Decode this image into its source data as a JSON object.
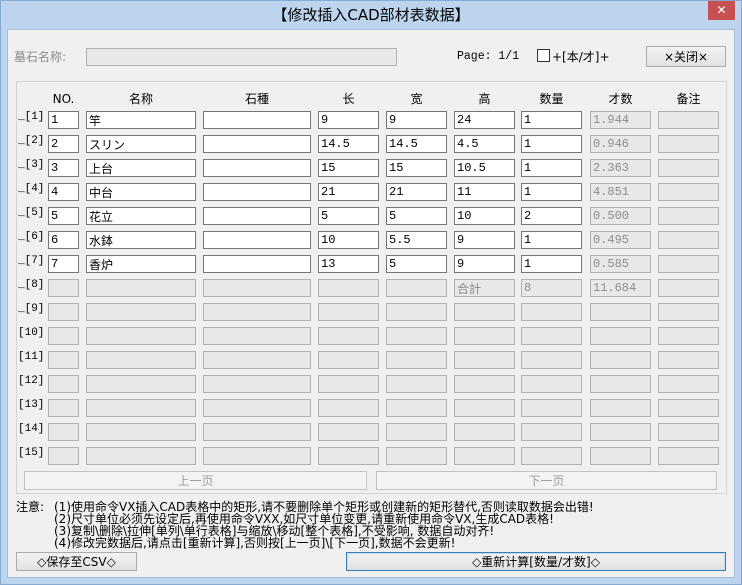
{
  "window": {
    "title": "【修改插入CAD部材表数据】",
    "close_glyph": "✕"
  },
  "header": {
    "name_label": "墓石名称:",
    "name_value": "",
    "page_text": "Page: 1/1",
    "unit_checkbox": {
      "label": "+[本/才]+",
      "checked": false
    },
    "close_button": "×关闭×"
  },
  "table": {
    "columns": [
      {
        "label": "NO.",
        "editable": true
      },
      {
        "label": "名称",
        "editable": true
      },
      {
        "label": "石種",
        "editable": true
      },
      {
        "label": "长",
        "editable": true
      },
      {
        "label": "宽",
        "editable": true
      },
      {
        "label": "高",
        "editable": true
      },
      {
        "label": "数量",
        "editable": true
      },
      {
        "label": "才数",
        "editable": false
      },
      {
        "label": "备注",
        "editable": false
      }
    ],
    "rows": [
      {
        "label": "_[1]",
        "active": true,
        "cells": [
          "1",
          "竿",
          "",
          "9",
          "9",
          "24",
          "1",
          "1.944",
          ""
        ]
      },
      {
        "label": "_[2]",
        "active": true,
        "cells": [
          "2",
          "スリン",
          "",
          "14.5",
          "14.5",
          "4.5",
          "1",
          "0.946",
          ""
        ]
      },
      {
        "label": "_[3]",
        "active": true,
        "cells": [
          "3",
          "上台",
          "",
          "15",
          "15",
          "10.5",
          "1",
          "2.363",
          ""
        ]
      },
      {
        "label": "_[4]",
        "active": true,
        "cells": [
          "4",
          "中台",
          "",
          "21",
          "21",
          "11",
          "1",
          "4.851",
          ""
        ]
      },
      {
        "label": "_[5]",
        "active": true,
        "cells": [
          "5",
          "花立",
          "",
          "5",
          "5",
          "10",
          "2",
          "0.500",
          ""
        ]
      },
      {
        "label": "_[6]",
        "active": true,
        "cells": [
          "6",
          "水鉢",
          "",
          "10",
          "5.5",
          "9",
          "1",
          "0.495",
          ""
        ]
      },
      {
        "label": "_[7]",
        "active": true,
        "cells": [
          "7",
          "香炉",
          "",
          "13",
          "5",
          "9",
          "1",
          "0.585",
          ""
        ]
      },
      {
        "label": "_[8]",
        "active": false,
        "cells": [
          "",
          "",
          "",
          "",
          "",
          "合計",
          "8",
          "11.684",
          ""
        ]
      },
      {
        "label": "_[9]",
        "active": false,
        "cells": [
          "",
          "",
          "",
          "",
          "",
          "",
          "",
          "",
          ""
        ]
      },
      {
        "label": "[10]",
        "active": false,
        "cells": [
          "",
          "",
          "",
          "",
          "",
          "",
          "",
          "",
          ""
        ]
      },
      {
        "label": "[11]",
        "active": false,
        "cells": [
          "",
          "",
          "",
          "",
          "",
          "",
          "",
          "",
          ""
        ]
      },
      {
        "label": "[12]",
        "active": false,
        "cells": [
          "",
          "",
          "",
          "",
          "",
          "",
          "",
          "",
          ""
        ]
      },
      {
        "label": "[13]",
        "active": false,
        "cells": [
          "",
          "",
          "",
          "",
          "",
          "",
          "",
          "",
          ""
        ]
      },
      {
        "label": "[14]",
        "active": false,
        "cells": [
          "",
          "",
          "",
          "",
          "",
          "",
          "",
          "",
          ""
        ]
      },
      {
        "label": "[15]",
        "active": false,
        "cells": [
          "",
          "",
          "",
          "",
          "",
          "",
          "",
          "",
          ""
        ]
      }
    ]
  },
  "pager": {
    "prev_label": "上一页",
    "next_label": "下一页"
  },
  "notes": {
    "label": "注意:",
    "lines": [
      "(1)使用命令VX插入CAD表格中的矩形,请不要删除单个矩形或创建新的矩形替代,否则读取数据会出错!",
      "(2)尺寸单位必须先设定后,再使用命令VXX,如尺寸单位变更,请重新使用命令VX,生成CAD表格!",
      "(3)复制\\删除\\拉伸[单列\\单行表格]与缩放\\移动[整个表格],不受影响, 数据自动对齐!",
      "(4)修改完数据后,请点击[重新计算],否则按[上一页]\\[下一页],数据不会更新!"
    ]
  },
  "footer": {
    "save_csv_label": "◇保存至CSV◇",
    "recalc_label": "◇重新计算[数量/才数]◇"
  },
  "colors": {
    "frame": "#bcd4ee",
    "client_background": "#f0f0f0",
    "close_button": "#c75050",
    "default_button_border": "#3c7fb1",
    "disabled_text": "#8c8c8c"
  }
}
